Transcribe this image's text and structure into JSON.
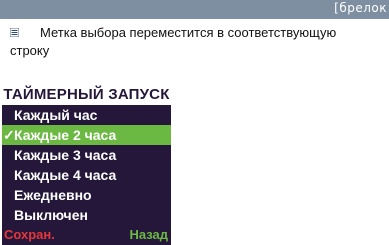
{
  "header": {
    "label": "[брелок"
  },
  "instruction": {
    "text": "Метка выбора переместится в соответствующую строку"
  },
  "device_screen": {
    "title": "ТАЙМЕРНЫЙ ЗАПУСК",
    "items": [
      {
        "label": "Каждый час",
        "selected": false
      },
      {
        "label": "Каждые 2 часа",
        "selected": true
      },
      {
        "label": "Каждые 3 часа",
        "selected": false
      },
      {
        "label": "Каждые 4 часа",
        "selected": false
      },
      {
        "label": "Ежедневно",
        "selected": false
      },
      {
        "label": "Выключен",
        "selected": false
      }
    ],
    "check_mark": "✓",
    "softkey_left": "Сохран.",
    "softkey_right": "Назад"
  },
  "colors": {
    "header_bar": "#7f8fa2",
    "screen_background": "#24173a",
    "selection_highlight": "#6bb843",
    "softkey_save": "#e5363a",
    "softkey_back": "#6bb843"
  },
  "icons": {
    "bullet": "list-bullet-icon",
    "check": "check-mark-icon"
  }
}
